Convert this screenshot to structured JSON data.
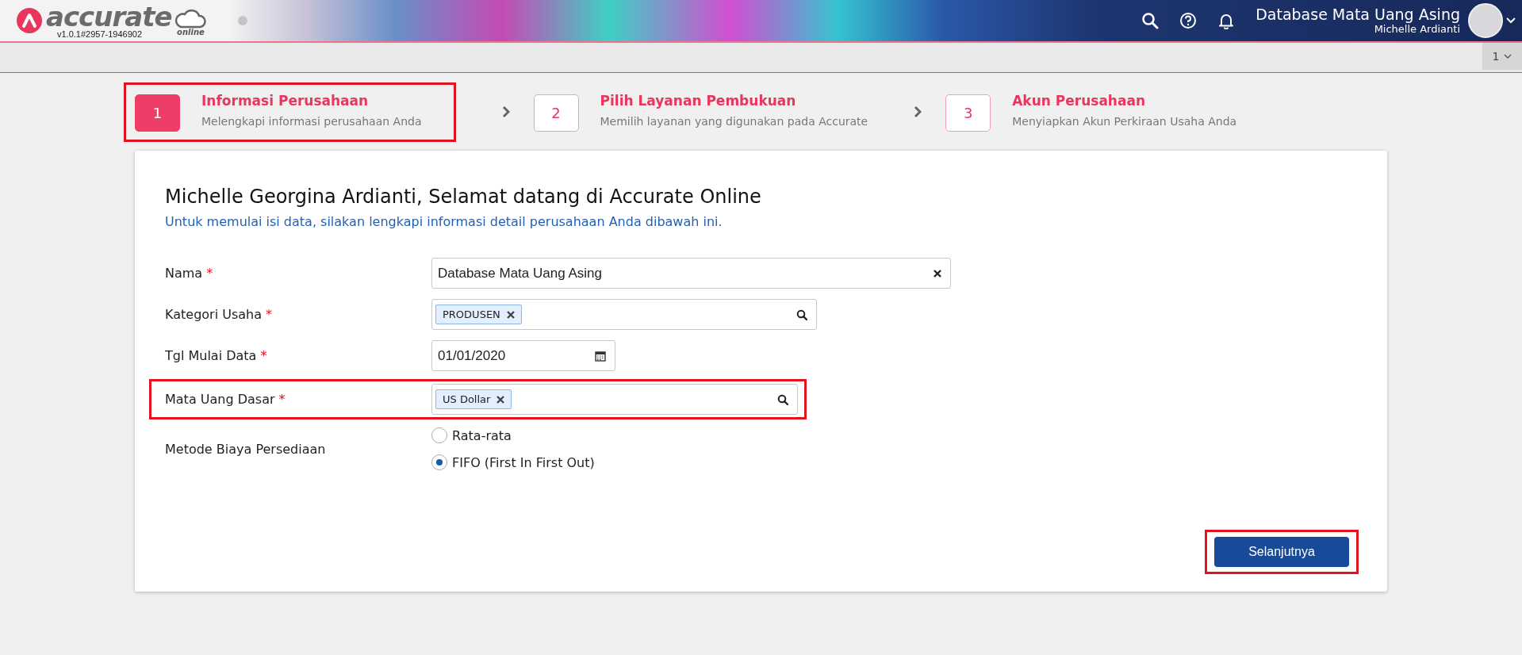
{
  "header": {
    "logo_text": "accurate",
    "logo_subtext": "online",
    "version": "v1.0.1#2957-1946902",
    "database_title": "Database Mata Uang Asing",
    "user_name": "Michelle Ardianti"
  },
  "tab_bar": {
    "tab_number": "1"
  },
  "steps": [
    {
      "number": "1",
      "title": "Informasi Perusahaan",
      "subtitle": "Melengkapi informasi perusahaan Anda",
      "selected": true,
      "highlighted": true
    },
    {
      "number": "2",
      "title": "Pilih Layanan Pembukuan",
      "subtitle": "Memilih layanan yang digunakan pada Accurate",
      "selected": false,
      "highlighted": false
    },
    {
      "number": "3",
      "title": "Akun Perusahaan",
      "subtitle": "Menyiapkan Akun Perkiraan Usaha Anda",
      "selected": false,
      "highlighted": false
    }
  ],
  "form": {
    "heading": "Michelle Georgina Ardianti, Selamat datang di Accurate Online",
    "intro": "Untuk memulai isi data, silakan lengkapi informasi detail perusahaan Anda dibawah ini.",
    "fields": [
      {
        "kind": "text",
        "label": "Nama",
        "required_mark": "*",
        "value": "Database Mata Uang Asing",
        "highlighted": false
      },
      {
        "kind": "tags",
        "label": "Kategori Usaha",
        "required_mark": "*",
        "tags": [
          "PRODUSEN"
        ],
        "highlighted": false
      },
      {
        "kind": "date",
        "label": "Tgl Mulai Data",
        "required_mark": "*",
        "value": "01/01/2020",
        "highlighted": false
      },
      {
        "kind": "tags",
        "label": "Mata Uang Dasar",
        "required_mark": "*",
        "tags": [
          "US Dollar"
        ],
        "highlighted": true
      },
      {
        "kind": "radio",
        "label": "Metode Biaya Persediaan",
        "highlighted": false,
        "options": [
          {
            "label": "Rata-rata",
            "selected": false
          },
          {
            "label": "FIFO (First In First Out)",
            "selected": true
          }
        ]
      }
    ]
  },
  "next_button": {
    "label": "Selanjutnya",
    "highlighted": true
  }
}
